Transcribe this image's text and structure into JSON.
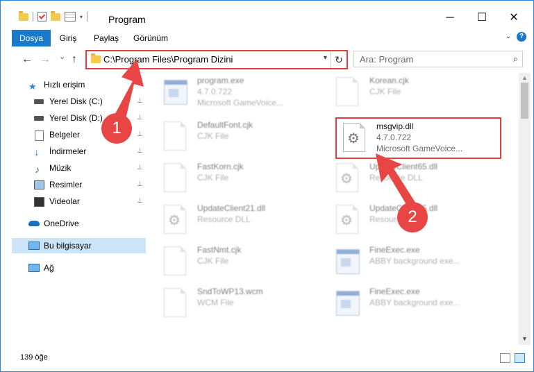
{
  "window": {
    "title": "Program",
    "minimize_glyph": "─",
    "maximize_glyph": "☐",
    "close_glyph": "✕"
  },
  "ribbon": {
    "tabs": [
      {
        "label": "Dosya"
      },
      {
        "label": "Giriş"
      },
      {
        "label": "Paylaş"
      },
      {
        "label": "Görünüm"
      }
    ],
    "help_label": "?"
  },
  "address": {
    "path": "C:\\Program Files\\Program Dizini",
    "refresh_glyph": "↻"
  },
  "search": {
    "placeholder": "Ara: Program",
    "icon_glyph": "⌕"
  },
  "nav_glyphs": {
    "back": "←",
    "forward": "→",
    "recent": "⌄",
    "up": "↑"
  },
  "sidebar": {
    "items": [
      {
        "label": "Hızlı erişim",
        "icon": "star-icon",
        "pinned": false
      },
      {
        "label": "Yerel Disk (C:)",
        "icon": "drive-icon",
        "pinned": true
      },
      {
        "label": "Yerel Disk (D:)",
        "icon": "drive-icon",
        "pinned": true
      },
      {
        "label": "Belgeler",
        "icon": "documents-icon",
        "pinned": true
      },
      {
        "label": "İndirmeler",
        "icon": "download-icon",
        "pinned": true
      },
      {
        "label": "Müzik",
        "icon": "music-icon",
        "pinned": true
      },
      {
        "label": "Resimler",
        "icon": "pictures-icon",
        "pinned": true
      },
      {
        "label": "Videolar",
        "icon": "videos-icon",
        "pinned": true
      },
      {
        "label": "OneDrive",
        "icon": "cloud-icon",
        "pinned": false
      },
      {
        "label": "Bu bilgisayar",
        "icon": "computer-icon",
        "pinned": false,
        "selected": true
      },
      {
        "label": "Ağ",
        "icon": "network-icon",
        "pinned": false
      }
    ],
    "pin_glyph": "📌"
  },
  "files": [
    {
      "name": "program.exe",
      "type": "4.7.0.722",
      "desc": "Microsoft GameVoice...",
      "icon": "exe-icon"
    },
    {
      "name": "Korean.cjk",
      "type": "CJK File",
      "desc": "",
      "icon": "document-icon"
    },
    {
      "name": "DefaultFont.cjk",
      "type": "CJK File",
      "desc": "",
      "icon": "document-icon"
    },
    {
      "name": "msgvip.dll",
      "type": "4.7.0.722",
      "desc": "Microsoft GameVoice...",
      "icon": "dll-gear-icon"
    },
    {
      "name": "FastKorn.cjk",
      "type": "CJK File",
      "desc": "",
      "icon": "document-icon"
    },
    {
      "name": "UpdateClient65.dll",
      "type": "Resource DLL",
      "desc": "",
      "icon": "dll-gear-icon"
    },
    {
      "name": "UpdateClient21.dll",
      "type": "Resource DLL",
      "desc": "",
      "icon": "dll-gear-icon"
    },
    {
      "name": "UpdateClient65.dll",
      "type": "Resource DLL",
      "desc": "",
      "icon": "dll-gear-icon"
    },
    {
      "name": "FastNmt.cjk",
      "type": "CJK File",
      "desc": "",
      "icon": "document-icon"
    },
    {
      "name": "FineExec.exe",
      "type": "ABBY background exe...",
      "desc": "",
      "icon": "exe-icon"
    },
    {
      "name": "SndToWP13.wcm",
      "type": "WCM File",
      "desc": "",
      "icon": "document-icon"
    },
    {
      "name": "FineExec.exe",
      "type": "ABBY background exe...",
      "desc": "",
      "icon": "exe-icon"
    }
  ],
  "status": {
    "count": "139 öğe"
  },
  "annotations": {
    "step1": "1",
    "step2": "2",
    "color": "#e84545"
  }
}
